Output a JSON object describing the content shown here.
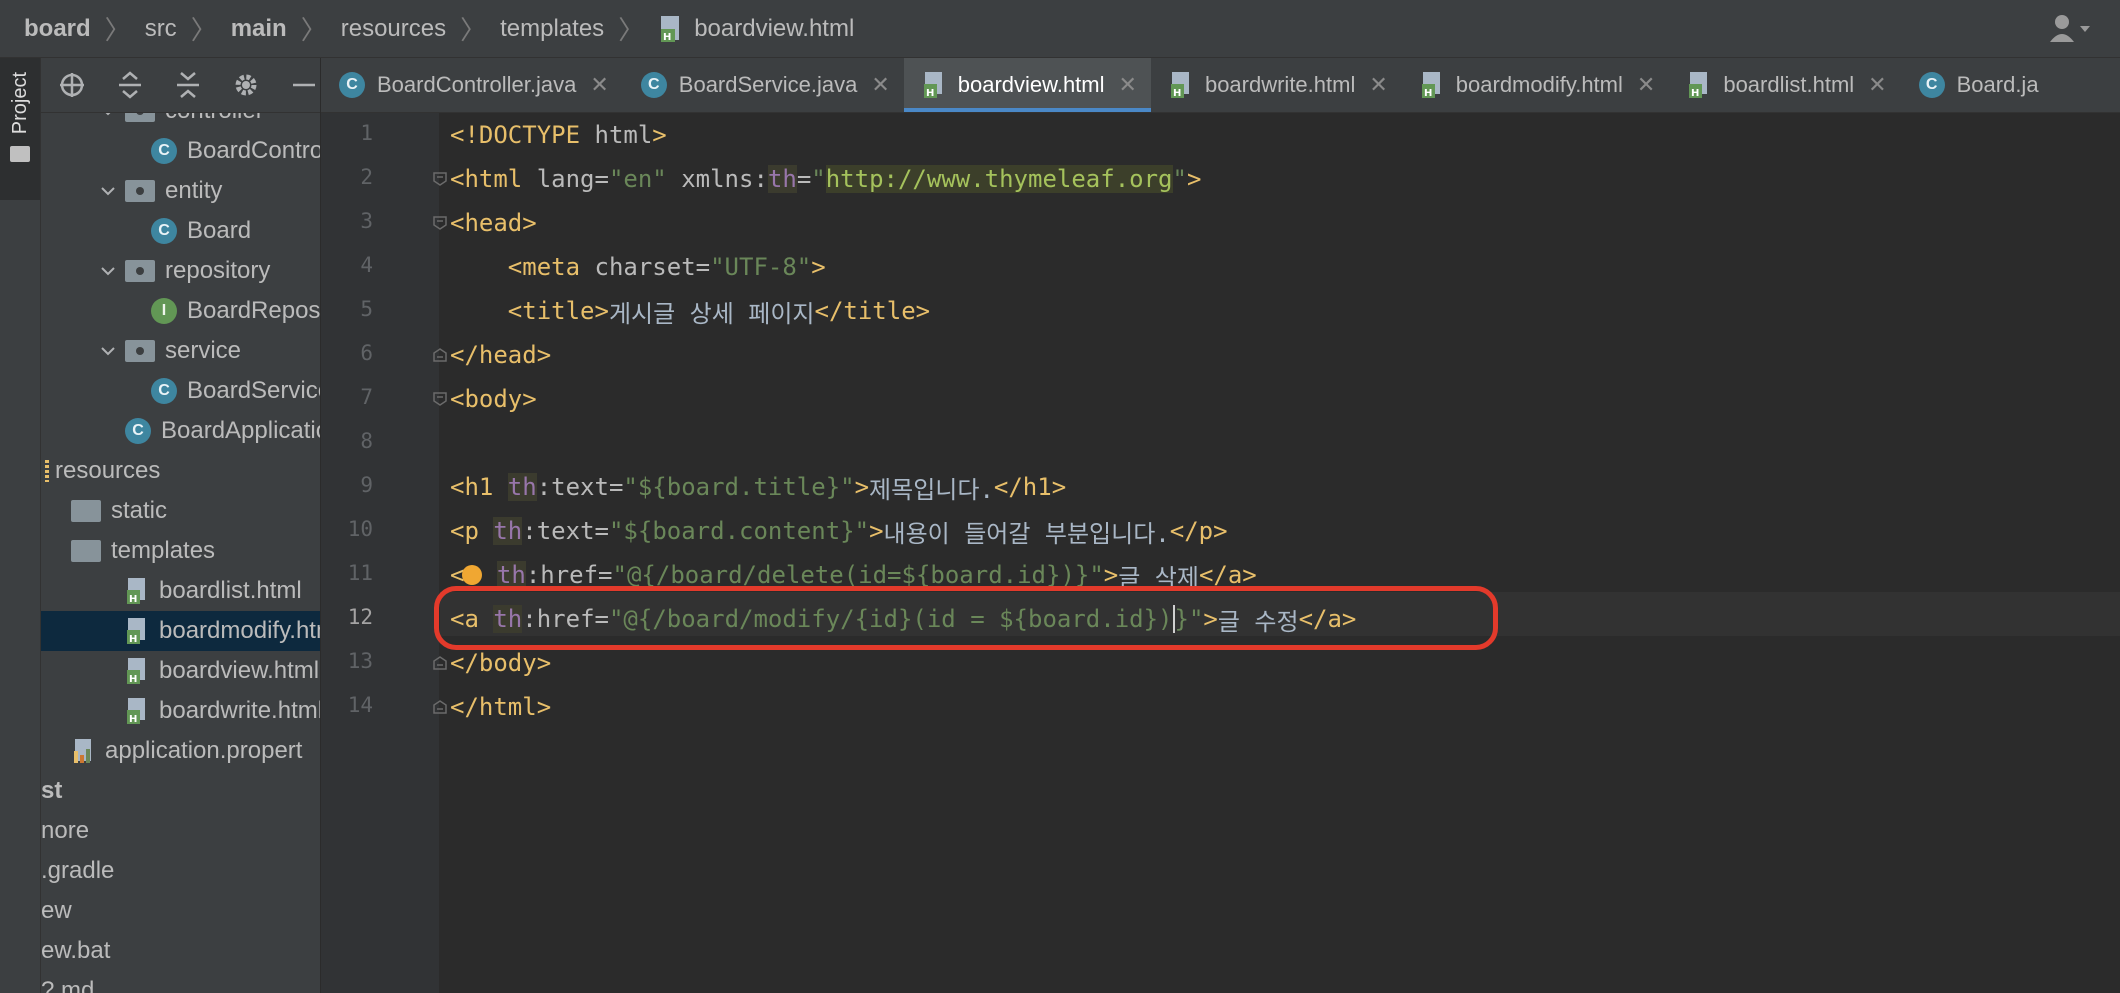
{
  "breadcrumb": {
    "items": [
      "board",
      "src",
      "main",
      "resources",
      "templates",
      "boardview.html"
    ]
  },
  "stripe": {
    "label": "Project"
  },
  "project_tree": [
    {
      "label": "controller",
      "kind": "package",
      "indent": 2,
      "chevron": "down"
    },
    {
      "label": "BoardControl",
      "kind": "class",
      "indent": 3
    },
    {
      "label": "entity",
      "kind": "package",
      "indent": 2,
      "chevron": "down"
    },
    {
      "label": "Board",
      "kind": "class",
      "indent": 3
    },
    {
      "label": "repository",
      "kind": "package",
      "indent": 2,
      "chevron": "down"
    },
    {
      "label": "BoardReposit",
      "kind": "interface",
      "indent": 3
    },
    {
      "label": "service",
      "kind": "package",
      "indent": 2,
      "chevron": "down"
    },
    {
      "label": "BoardService",
      "kind": "class",
      "indent": 3
    },
    {
      "label": "BoardApplication",
      "kind": "class-run",
      "indent": 2
    },
    {
      "label": "resources",
      "kind": "resources",
      "indent": 0
    },
    {
      "label": "static",
      "kind": "folder",
      "indent": 1
    },
    {
      "label": "templates",
      "kind": "folder",
      "indent": 1
    },
    {
      "label": "boardlist.html",
      "kind": "html",
      "indent": 2
    },
    {
      "label": "boardmodify.htm",
      "kind": "html",
      "indent": 2,
      "selected": true
    },
    {
      "label": "boardview.html",
      "kind": "html",
      "indent": 2
    },
    {
      "label": "boardwrite.html",
      "kind": "html",
      "indent": 2
    },
    {
      "label": "application.propert",
      "kind": "props",
      "indent": 1
    },
    {
      "label": "st",
      "kind": "bold",
      "indent": -1
    },
    {
      "label": "nore",
      "kind": "text",
      "indent": -1
    },
    {
      "label": ".gradle",
      "kind": "text",
      "indent": -1
    },
    {
      "label": "ew",
      "kind": "text",
      "indent": -1
    },
    {
      "label": "ew.bat",
      "kind": "text",
      "indent": -1
    },
    {
      "label": "? md",
      "kind": "text",
      "indent": -1
    }
  ],
  "tabs": [
    {
      "label": "BoardController.java",
      "kind": "class",
      "active": false
    },
    {
      "label": "BoardService.java",
      "kind": "class",
      "active": false
    },
    {
      "label": "boardview.html",
      "kind": "html",
      "active": true
    },
    {
      "label": "boardwrite.html",
      "kind": "html",
      "active": false
    },
    {
      "label": "boardmodify.html",
      "kind": "html",
      "active": false
    },
    {
      "label": "boardlist.html",
      "kind": "html",
      "active": false
    },
    {
      "label": "Board.ja",
      "kind": "class",
      "active": false
    }
  ],
  "editor": {
    "current_line": 12,
    "lines": [
      {
        "n": "1",
        "tokens": [
          [
            "tag",
            "<!DOCTYPE "
          ],
          [
            "attr",
            "html"
          ],
          [
            "tag",
            ">"
          ]
        ]
      },
      {
        "n": "2",
        "tokens": [
          [
            "tag",
            "<html "
          ],
          [
            "attr",
            "lang="
          ],
          [
            "str",
            "\"en\""
          ],
          [
            "attr",
            " xmlns:"
          ],
          [
            "ns",
            "th"
          ],
          [
            "attr",
            "="
          ],
          [
            "str",
            "\""
          ],
          [
            "strv",
            "http://www.thymeleaf.org"
          ],
          [
            "str",
            "\""
          ],
          [
            "tag",
            ">"
          ]
        ]
      },
      {
        "n": "3",
        "tokens": [
          [
            "tag",
            "<head>"
          ]
        ]
      },
      {
        "n": "4",
        "tokens": [
          [
            "text",
            "    "
          ],
          [
            "tag",
            "<meta "
          ],
          [
            "attr",
            "charset="
          ],
          [
            "str",
            "\"UTF-8\""
          ],
          [
            "tag",
            ">"
          ]
        ]
      },
      {
        "n": "5",
        "tokens": [
          [
            "text",
            "    "
          ],
          [
            "tag",
            "<title>"
          ],
          [
            "text",
            "게시글 상세 페이지"
          ],
          [
            "tag",
            "</title>"
          ]
        ]
      },
      {
        "n": "6",
        "tokens": [
          [
            "tag",
            "</head>"
          ]
        ]
      },
      {
        "n": "7",
        "tokens": [
          [
            "tag",
            "<body>"
          ]
        ]
      },
      {
        "n": "8",
        "tokens": []
      },
      {
        "n": "9",
        "tokens": [
          [
            "tag",
            "<h1 "
          ],
          [
            "ns",
            "th"
          ],
          [
            "attr",
            ":text="
          ],
          [
            "str",
            "\"${board.title}\""
          ],
          [
            "tag",
            ">"
          ],
          [
            "text",
            "제목입니다."
          ],
          [
            "tag",
            "</h1>"
          ]
        ]
      },
      {
        "n": "10",
        "tokens": [
          [
            "tag",
            "<p "
          ],
          [
            "ns",
            "th"
          ],
          [
            "attr",
            ":text="
          ],
          [
            "str",
            "\"${board.content}\""
          ],
          [
            "tag",
            ">"
          ],
          [
            "text",
            "내용이 들어갈 부분입니다."
          ],
          [
            "tag",
            "</p>"
          ]
        ]
      },
      {
        "n": "11",
        "tokens": [
          [
            "tag",
            "<"
          ],
          [
            "bulb",
            ""
          ],
          [
            "text",
            " "
          ],
          [
            "ns",
            "th"
          ],
          [
            "attr",
            ":href="
          ],
          [
            "str",
            "\"@{/board/delete(id=${board.id})}\""
          ],
          [
            "tag",
            ">"
          ],
          [
            "text",
            "글 삭제"
          ],
          [
            "tag",
            "</a>"
          ]
        ]
      },
      {
        "n": "12",
        "tokens": [
          [
            "tag",
            "<a "
          ],
          [
            "ns",
            "th"
          ],
          [
            "attr",
            ":href="
          ],
          [
            "str",
            "\"@{/board/modify/{id}(id = ${board.id})"
          ],
          [
            "caret",
            ""
          ],
          [
            "str",
            "}\""
          ],
          [
            "tag",
            ">"
          ],
          [
            "text",
            "글 수정"
          ],
          [
            "tag",
            "</a>"
          ]
        ]
      },
      {
        "n": "13",
        "tokens": [
          [
            "tag",
            "</body>"
          ]
        ]
      },
      {
        "n": "14",
        "tokens": [
          [
            "tag",
            "</html>"
          ]
        ]
      }
    ]
  },
  "colors": {
    "tag": "#e8bf6a",
    "attr": "#bababa",
    "namespace": "#9876aa",
    "string": "#6a8759",
    "annotation": "#e33a2b",
    "active_tab_underline": "#4a88c7"
  }
}
